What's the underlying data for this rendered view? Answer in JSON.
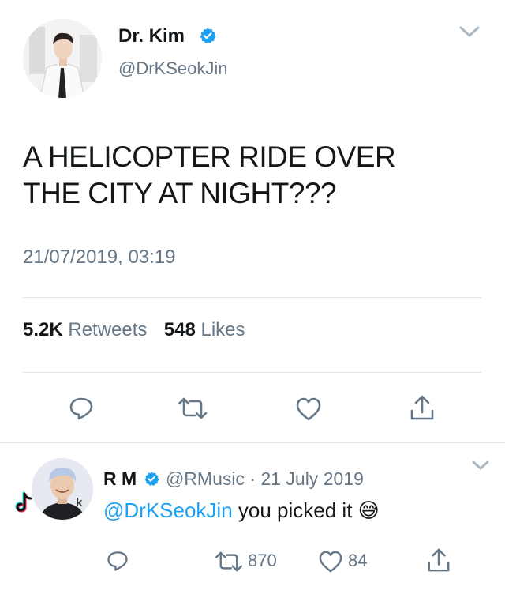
{
  "tweet": {
    "author_name": "Dr. Kim",
    "handle": "@DrKSeokJin",
    "text_line1": "A HELICOPTER RIDE OVER",
    "text_line2": "THE CITY AT NIGHT???",
    "timestamp": "21/07/2019, 03:19",
    "retweet_count": "5.2K",
    "retweet_label": "Retweets",
    "like_count": "548",
    "like_label": "Likes"
  },
  "reply": {
    "author_name": "R M",
    "handle": "@RMusic",
    "separator": "·",
    "date": "21 July 2019",
    "mention": "@DrKSeokJin",
    "text": "you picked it",
    "emoji": "😅",
    "retweet_count": "870",
    "like_count": "84",
    "watermark": "k"
  },
  "colors": {
    "accent": "#1da1f2",
    "muted": "#657786",
    "divider": "#e1e8ed"
  },
  "icons": {
    "tweet_actions": [
      "reply-icon",
      "retweet-icon",
      "like-icon",
      "share-icon"
    ],
    "reply_actions": [
      "reply-icon",
      "retweet-icon",
      "like-icon",
      "share-icon"
    ]
  }
}
